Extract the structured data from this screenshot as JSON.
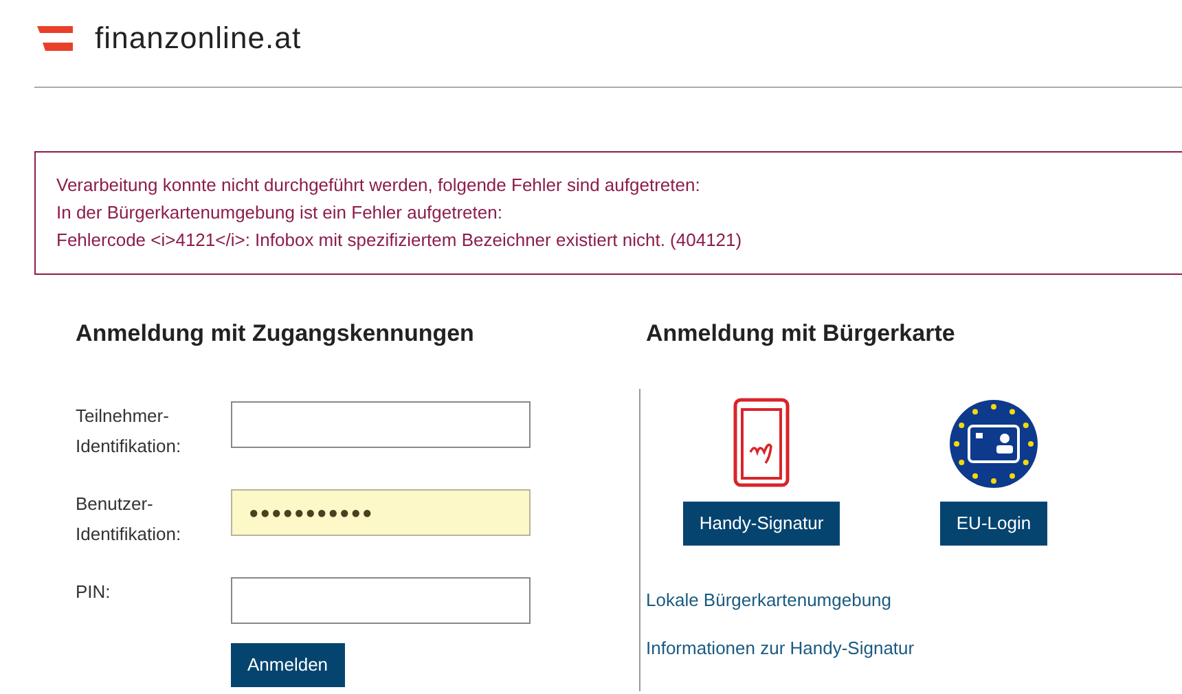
{
  "logo": {
    "text": "finanzonline.at"
  },
  "error_box": {
    "lines": [
      "Verarbeitung konnte nicht durchgeführt werden, folgende Fehler sind aufgetreten:",
      "In der Bürgerkartenumgebung ist ein Fehler aufgetreten:",
      "Fehlercode <i>4121</i>: Infobox mit spezifiziertem Bezeichner existiert nicht. (404121)"
    ]
  },
  "login_form": {
    "heading": "Anmeldung mit Zugangskennungen",
    "fields": [
      {
        "label_lines": [
          "Teilnehmer-",
          "Identifikation:"
        ],
        "autofilled": false
      },
      {
        "label_lines": [
          "Benutzer-",
          "Identifikation:"
        ],
        "value": "●●●●●●●●●●●",
        "autofilled": true
      },
      {
        "label_lines": [
          "PIN:"
        ],
        "autofilled": false
      }
    ],
    "submit": "Anmelden"
  },
  "citizen_card": {
    "heading": "Anmeldung mit Bürgerkarte",
    "options": [
      {
        "kind": "phone",
        "button": "Handy-Signatur"
      },
      {
        "kind": "eu",
        "button": "EU-Login"
      }
    ],
    "links": [
      "Lokale Bürgerkartenumgebung",
      "Informationen zur Handy-Signatur"
    ]
  }
}
